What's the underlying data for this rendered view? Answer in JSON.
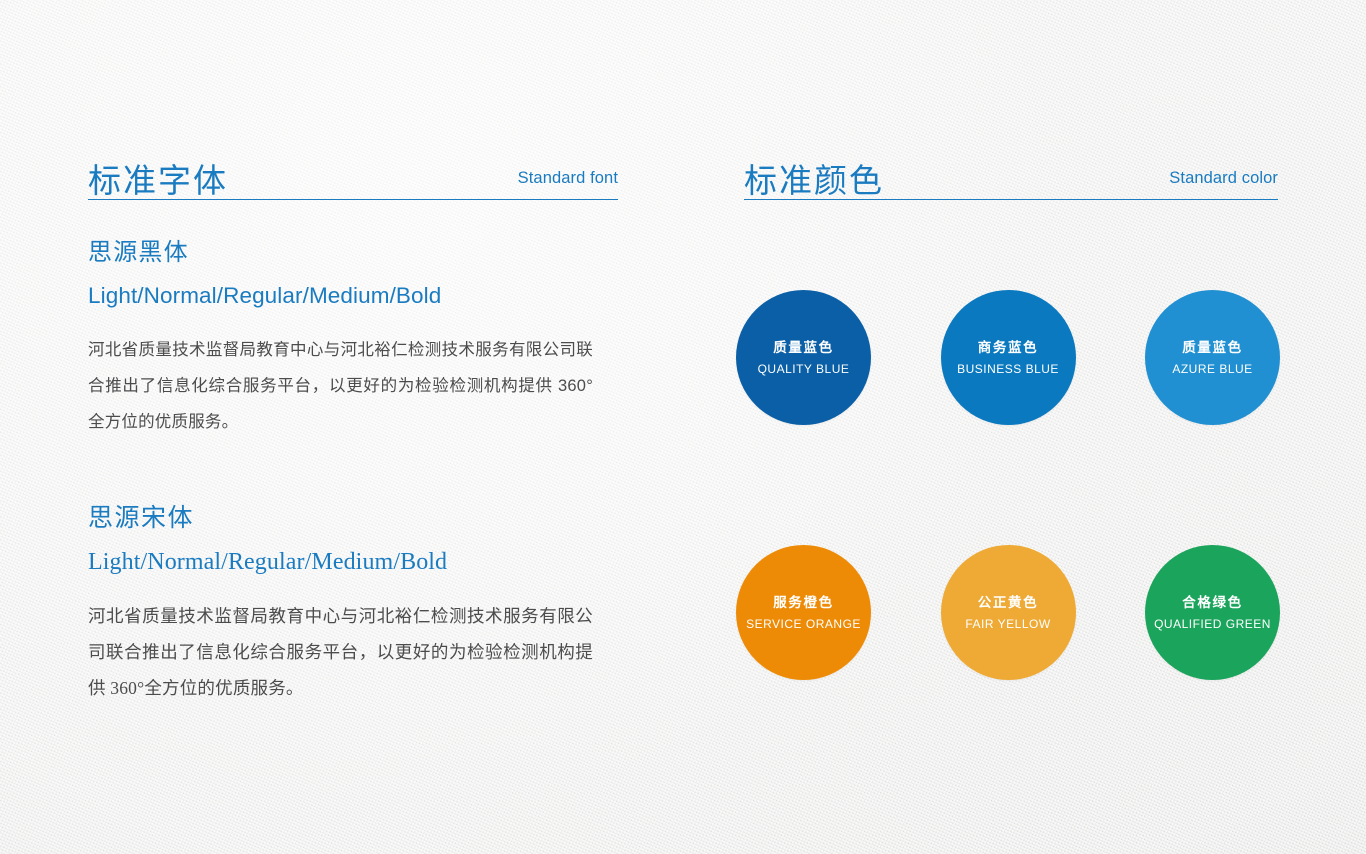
{
  "background_color": "#eeeeec",
  "accent_color": "#1a7bc0",
  "font_panel": {
    "title": "标准字体",
    "title_en": "Standard font",
    "specimens": [
      {
        "name": "思源黑体",
        "weights": "Light/Normal/Regular/Medium/Bold",
        "body": "河北省质量技术监督局教育中心与河北裕仁检测技术服务有限公司联合推出了信息化综合服务平台，以更好的为检验检测机构提供 360°全方位的优质服务。"
      },
      {
        "name": "思源宋体",
        "weights": "Light/Normal/Regular/Medium/Bold",
        "body": "河北省质量技术监督局教育中心与河北裕仁检测技术服务有限公司联合推出了信息化综合服务平台，以更好的为检验检测机构提供 360°全方位的优质服务。"
      }
    ]
  },
  "color_panel": {
    "title": "标准颜色",
    "title_en": "Standard color",
    "swatches": [
      {
        "cn": "质量蓝色",
        "en": "QUALITY BLUE",
        "hex": "#0a5fa6"
      },
      {
        "cn": "商务蓝色",
        "en": "BUSINESS BLUE",
        "hex": "#0b79bf"
      },
      {
        "cn": "质量蓝色",
        "en": "AZURE BLUE",
        "hex": "#2090d2"
      },
      {
        "cn": "服务橙色",
        "en": "SERVICE ORANGE",
        "hex": "#ed8b06"
      },
      {
        "cn": "公正黄色",
        "en": "FAIR YELLOW",
        "hex": "#eeaa35"
      },
      {
        "cn": "合格绿色",
        "en": "QUALIFIED GREEN",
        "hex": "#1ba45c"
      }
    ]
  }
}
